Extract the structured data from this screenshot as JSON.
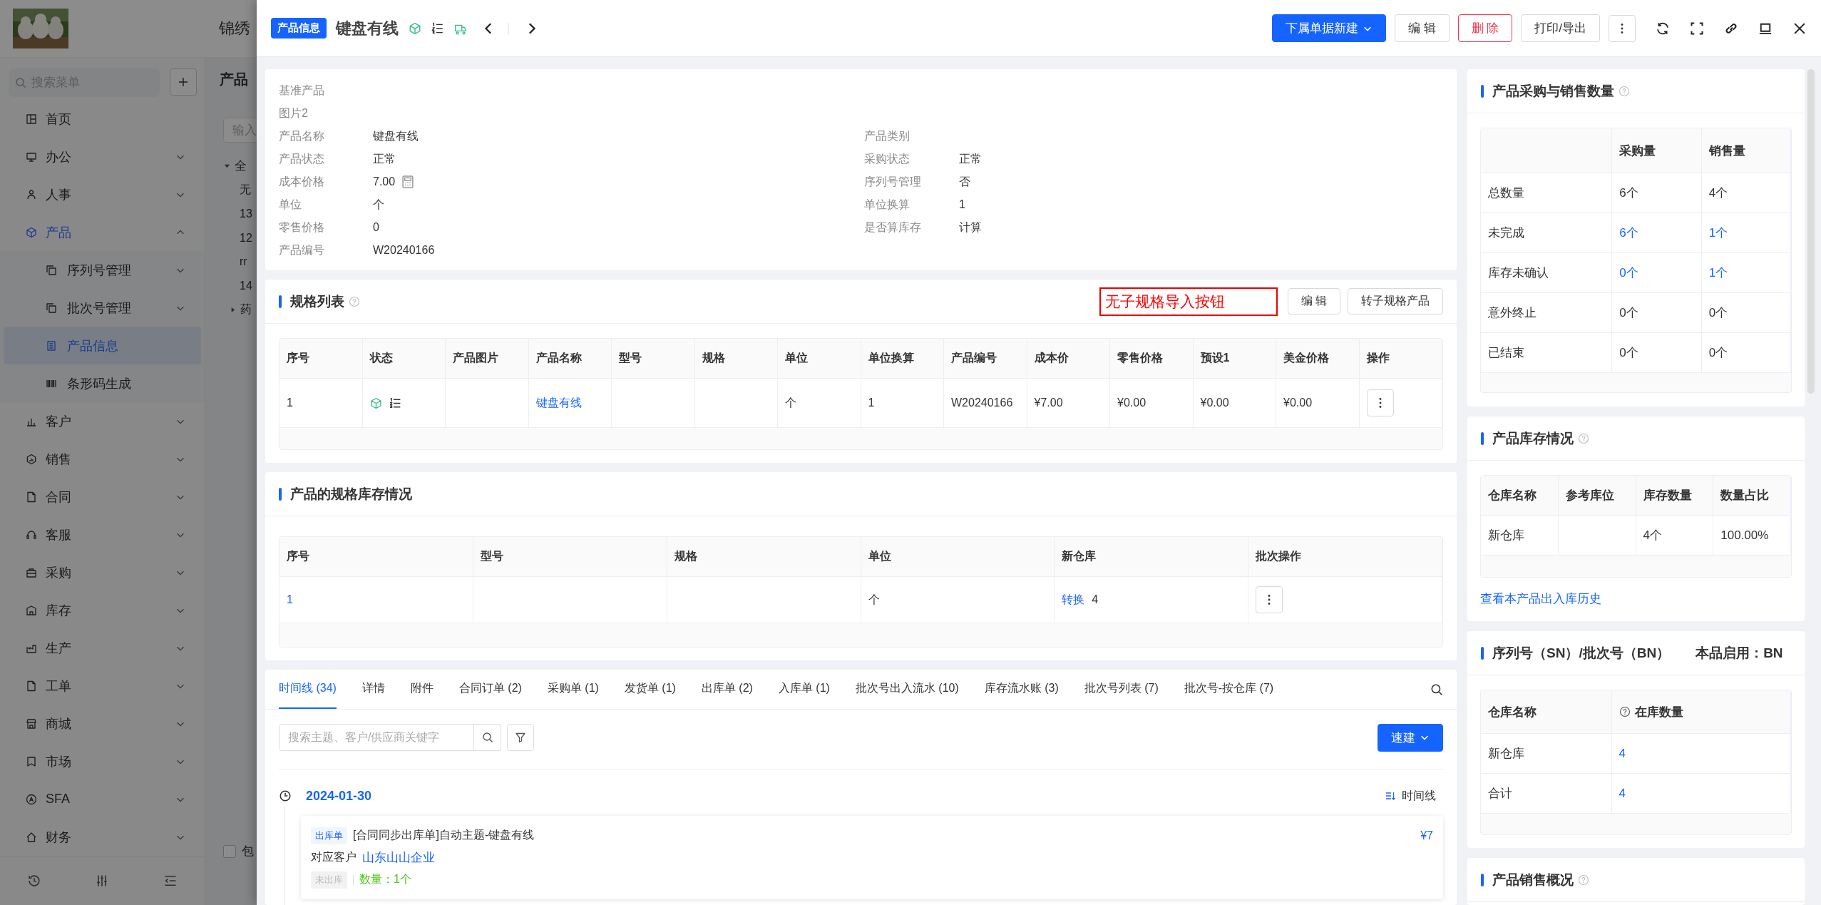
{
  "app": {
    "title": "锦绣",
    "search": {
      "placeholder": "搜索菜单"
    },
    "menu": [
      {
        "label": "首页",
        "kind": "link",
        "selected": false
      },
      {
        "label": "办公",
        "kind": "group",
        "expanded": false,
        "selected": false
      },
      {
        "label": "人事",
        "kind": "group",
        "expanded": false,
        "selected": false
      },
      {
        "label": "产品",
        "kind": "group",
        "expanded": true,
        "selected": true,
        "children": [
          {
            "label": "序列号管理",
            "kind": "group",
            "expanded": false,
            "selected": false
          },
          {
            "label": "批次号管理",
            "kind": "group",
            "expanded": false,
            "selected": false
          },
          {
            "label": "产品信息",
            "kind": "link",
            "selected": true
          },
          {
            "label": "条形码生成",
            "kind": "link",
            "selected": false
          }
        ]
      },
      {
        "label": "客户",
        "kind": "group",
        "expanded": false,
        "selected": false
      },
      {
        "label": "销售",
        "kind": "group",
        "expanded": false,
        "selected": false
      },
      {
        "label": "合同",
        "kind": "group",
        "expanded": false,
        "selected": false
      },
      {
        "label": "客服",
        "kind": "group",
        "expanded": false,
        "selected": false
      },
      {
        "label": "采购",
        "kind": "group",
        "expanded": false,
        "selected": false
      },
      {
        "label": "库存",
        "kind": "group",
        "expanded": false,
        "selected": false
      },
      {
        "label": "生产",
        "kind": "group",
        "expanded": false,
        "selected": false
      },
      {
        "label": "工单",
        "kind": "group",
        "expanded": false,
        "selected": false
      },
      {
        "label": "商城",
        "kind": "group",
        "expanded": false,
        "selected": false
      },
      {
        "label": "市场",
        "kind": "group",
        "expanded": false,
        "selected": false
      },
      {
        "label": "SFA",
        "kind": "group",
        "expanded": false,
        "selected": false
      },
      {
        "label": "财务",
        "kind": "group",
        "expanded": false,
        "selected": false
      }
    ]
  },
  "background_page": {
    "title": "产品",
    "search": {
      "placeholder": "输入"
    },
    "tree": [
      {
        "label": "全",
        "kind": "branch",
        "expanded": true,
        "children": [
          {
            "label": "无",
            "kind": "leaf"
          },
          {
            "label": "13",
            "kind": "leaf"
          },
          {
            "label": "12",
            "kind": "leaf"
          },
          {
            "label": "rr",
            "kind": "leaf"
          },
          {
            "label": "14",
            "kind": "leaf"
          },
          {
            "label": "药",
            "kind": "branch",
            "expanded": false
          }
        ]
      }
    ],
    "checkbox": {
      "label": "包",
      "checked": false
    }
  },
  "drawer": {
    "badge": "产品信息",
    "title": "键盘有线",
    "actions": [
      {
        "kind": "primary-dropdown",
        "label": "下属单据新建"
      },
      {
        "kind": "default",
        "label": "编 辑"
      },
      {
        "kind": "danger",
        "label": "删 除"
      },
      {
        "kind": "default",
        "label": "打印/导出"
      },
      {
        "kind": "more"
      }
    ],
    "info": {
      "rows": [
        {
          "cells": [
            {
              "kind": "text",
              "label": "基准产品"
            }
          ]
        },
        {
          "cells": [
            {
              "kind": "text",
              "label": "图片2"
            }
          ]
        },
        {
          "cells": [
            {
              "kind": "text",
              "label": "产品名称",
              "value": "键盘有线"
            },
            {
              "kind": "text",
              "label": "产品类别"
            }
          ]
        },
        {
          "cells": [
            {
              "kind": "text",
              "label": "产品状态",
              "value": "正常"
            },
            {
              "kind": "text",
              "label": "采购状态",
              "value": "正常"
            }
          ]
        },
        {
          "cells": [
            {
              "kind": "price",
              "label": "成本价格",
              "value": "7.00"
            },
            {
              "kind": "text",
              "label": "序列号管理",
              "value": "否"
            }
          ]
        },
        {
          "cells": [
            {
              "kind": "text",
              "label": "单位",
              "value": "个"
            },
            {
              "kind": "text",
              "label": "单位换算",
              "value": "1"
            }
          ]
        },
        {
          "cells": [
            {
              "kind": "text",
              "label": "零售价格",
              "value": "0"
            },
            {
              "kind": "text",
              "label": "是否算库存",
              "value": "计算"
            }
          ]
        },
        {
          "cells": [
            {
              "kind": "text",
              "label": "产品编号",
              "value": "W20240166"
            }
          ]
        }
      ]
    },
    "spec_list": {
      "title": "规格列表",
      "help": true,
      "note": "无子规格导入按钮",
      "buttons": [
        "编 辑",
        "转子规格产品"
      ],
      "table": {
        "columns": [
          {
            "label": "序号"
          },
          {
            "label": "状态"
          },
          {
            "label": "产品图片"
          },
          {
            "label": "产品名称"
          },
          {
            "label": "型号"
          },
          {
            "label": "规格"
          },
          {
            "label": "单位"
          },
          {
            "label": "单位换算"
          },
          {
            "label": "产品编号"
          },
          {
            "label": "成本价"
          },
          {
            "label": "零售价格"
          },
          {
            "label": "预设1"
          },
          {
            "label": "美金价格"
          },
          {
            "label": "操作"
          }
        ],
        "rows": [
          {
            "cells": [
              {
                "kind": "text",
                "text": "1"
              },
              {
                "kind": "status"
              },
              {
                "kind": "empty"
              },
              {
                "kind": "link",
                "text": "键盘有线"
              },
              {
                "kind": "empty"
              },
              {
                "kind": "empty"
              },
              {
                "kind": "text",
                "text": "个"
              },
              {
                "kind": "text",
                "text": "1"
              },
              {
                "kind": "text",
                "text": "W20240166"
              },
              {
                "kind": "text",
                "text": "¥7.00"
              },
              {
                "kind": "text",
                "text": "¥0.00"
              },
              {
                "kind": "text",
                "text": "¥0.00"
              },
              {
                "kind": "text",
                "text": "¥0.00"
              },
              {
                "kind": "menu"
              }
            ]
          }
        ]
      }
    },
    "spec_stock": {
      "title": "产品的规格库存情况",
      "help": false,
      "table": {
        "columns": [
          {
            "label": "序号"
          },
          {
            "label": "型号"
          },
          {
            "label": "规格"
          },
          {
            "label": "单位"
          },
          {
            "label": "新仓库"
          },
          {
            "label": "批次操作"
          }
        ],
        "rows": [
          {
            "cells": [
              {
                "kind": "link",
                "text": "1"
              },
              {
                "kind": "empty"
              },
              {
                "kind": "empty"
              },
              {
                "kind": "text",
                "text": "个"
              },
              {
                "kind": "action",
                "link": "转换",
                "text": "4"
              },
              {
                "kind": "menu"
              }
            ]
          }
        ]
      }
    },
    "activity": {
      "tabs": [
        {
          "label": "时间线 (34)",
          "selected": true
        },
        {
          "label": "详情",
          "selected": false
        },
        {
          "label": "附件",
          "selected": false
        },
        {
          "label": "合同订单 (2)",
          "selected": false
        },
        {
          "label": "采购单 (1)",
          "selected": false
        },
        {
          "label": "发货单 (1)",
          "selected": false
        },
        {
          "label": "出库单 (2)",
          "selected": false
        },
        {
          "label": "入库单 (1)",
          "selected": false
        },
        {
          "label": "批次号出入流水 (10)",
          "selected": false
        },
        {
          "label": "库存流水账 (3)",
          "selected": false
        },
        {
          "label": "批次号列表 (7)",
          "selected": false
        },
        {
          "label": "批次号-按仓库 (7)",
          "selected": false
        }
      ],
      "search": {
        "placeholder": "搜索主题、客户/供应商关键字"
      },
      "quick_create": "速建",
      "view_toggle": "时间线",
      "groups": [
        {
          "date": "2024-01-30",
          "entries": [
            {
              "tag": "出库单",
              "title": "[合同同步出库单]自动主题-键盘有线",
              "amount": "¥7",
              "customer_label": "对应客户",
              "customer": "山东山山企业",
              "status": "未出库",
              "quantity": "数量：1个"
            }
          ]
        }
      ]
    },
    "side": {
      "purchase_sales": {
        "title": "产品采购与销售数量",
        "help": true,
        "table": {
          "columns": [
            {},
            {
              "label": "采购量"
            },
            {
              "label": "销售量"
            }
          ],
          "rows": [
            {
              "cells": [
                {
                  "kind": "text",
                  "text": "总数量"
                },
                {
                  "kind": "text",
                  "text": "6个"
                },
                {
                  "kind": "text",
                  "text": "4个"
                }
              ]
            },
            {
              "cells": [
                {
                  "kind": "text",
                  "text": "未完成"
                },
                {
                  "kind": "link",
                  "text": "6个"
                },
                {
                  "kind": "link",
                  "text": "1个"
                }
              ]
            },
            {
              "cells": [
                {
                  "kind": "text",
                  "text": "库存未确认"
                },
                {
                  "kind": "link",
                  "text": "0个"
                },
                {
                  "kind": "link",
                  "text": "1个"
                }
              ]
            },
            {
              "cells": [
                {
                  "kind": "text",
                  "text": "意外终止"
                },
                {
                  "kind": "text",
                  "text": "0个"
                },
                {
                  "kind": "text",
                  "text": "0个"
                }
              ]
            },
            {
              "cells": [
                {
                  "kind": "text",
                  "text": "已结束"
                },
                {
                  "kind": "text",
                  "text": "0个"
                },
                {
                  "kind": "text",
                  "text": "0个"
                }
              ]
            }
          ]
        }
      },
      "inventory": {
        "title": "产品库存情况",
        "help": true,
        "table": {
          "columns": [
            {
              "label": "仓库名称"
            },
            {
              "label": "参考库位"
            },
            {
              "label": "库存数量"
            },
            {
              "label": "数量占比"
            }
          ],
          "rows": [
            {
              "cells": [
                {
                  "kind": "text",
                  "text": "新仓库"
                },
                {
                  "kind": "empty"
                },
                {
                  "kind": "text",
                  "text": "4个"
                },
                {
                  "kind": "text",
                  "text": "100.00%"
                }
              ]
            }
          ]
        },
        "history_link": "查看本产品出入库历史"
      },
      "serial_batch": {
        "title": "序列号（SN）/批次号（BN）",
        "enabled": "本品启用：BN",
        "help": false,
        "table": {
          "columns": [
            {
              "label": "仓库名称",
              "help": false
            },
            {
              "label": "在库数量",
              "help": true
            }
          ],
          "rows": [
            {
              "cells": [
                {
                  "kind": "text",
                  "text": "新仓库"
                },
                {
                  "kind": "link",
                  "text": "4"
                }
              ]
            },
            {
              "cells": [
                {
                  "kind": "text",
                  "text": "合计"
                },
                {
                  "kind": "link",
                  "text": "4"
                }
              ]
            }
          ]
        }
      },
      "sales_overview": {
        "title": "产品销售概况",
        "help": true
      }
    }
  }
}
